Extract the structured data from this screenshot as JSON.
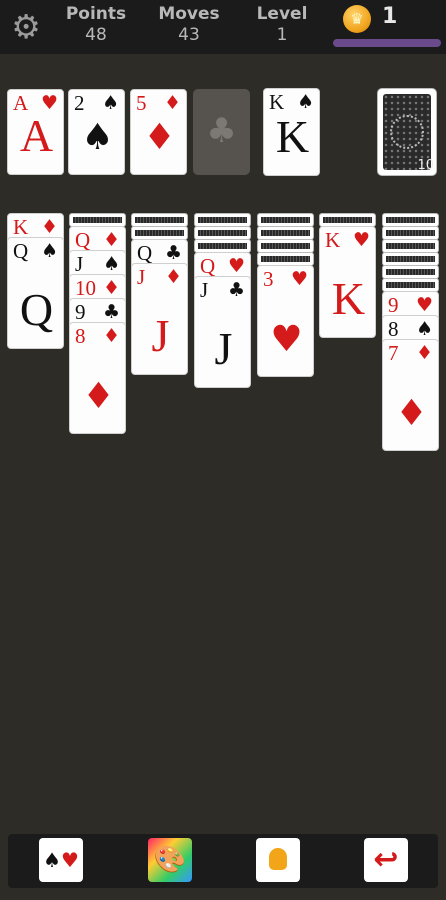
{
  "header": {
    "points_label": "Points",
    "points_value": "48",
    "moves_label": "Moves",
    "moves_value": "43",
    "level_label": "Level",
    "level_value": "1",
    "coins": "1"
  },
  "foundations": [
    {
      "rank": "A",
      "suit": "♥",
      "color": "red"
    },
    {
      "rank": "2",
      "suit": "♠",
      "color": "black"
    },
    {
      "rank": "5",
      "suit": "♦",
      "color": "red"
    },
    {
      "empty": true,
      "suit": "♣"
    }
  ],
  "waste": {
    "rank": "K",
    "suit": "♠",
    "color": "black"
  },
  "stock": {
    "count": "10"
  },
  "tableau": [
    {
      "hidden": 0,
      "cards": [
        {
          "rank": "K",
          "suit": "♦",
          "color": "red"
        },
        {
          "rank": "Q",
          "suit": "♠",
          "color": "black"
        }
      ]
    },
    {
      "hidden": 1,
      "cards": [
        {
          "rank": "Q",
          "suit": "♦",
          "color": "red"
        },
        {
          "rank": "J",
          "suit": "♠",
          "color": "black"
        },
        {
          "rank": "10",
          "suit": "♦",
          "color": "red"
        },
        {
          "rank": "9",
          "suit": "♣",
          "color": "black"
        },
        {
          "rank": "8",
          "suit": "♦",
          "color": "red"
        }
      ]
    },
    {
      "hidden": 2,
      "cards": [
        {
          "rank": "Q",
          "suit": "♣",
          "color": "black"
        },
        {
          "rank": "J",
          "suit": "♦",
          "color": "red"
        }
      ]
    },
    {
      "hidden": 3,
      "cards": [
        {
          "rank": "Q",
          "suit": "♥",
          "color": "red"
        },
        {
          "rank": "J",
          "suit": "♣",
          "color": "black"
        }
      ]
    },
    {
      "hidden": 4,
      "cards": [
        {
          "rank": "3",
          "suit": "♥",
          "color": "red"
        }
      ]
    },
    {
      "hidden": 1,
      "cards": [
        {
          "rank": "K",
          "suit": "♥",
          "color": "red"
        }
      ]
    },
    {
      "hidden": 6,
      "cards": [
        {
          "rank": "9",
          "suit": "♥",
          "color": "red"
        },
        {
          "rank": "8",
          "suit": "♠",
          "color": "black"
        },
        {
          "rank": "7",
          "suit": "♦",
          "color": "red"
        }
      ]
    }
  ],
  "toolbar": {
    "suits_icon": "card-suits-icon",
    "theme_icon": "palette-icon",
    "hint_icon": "lightbulb-icon",
    "undo_icon": "undo-arrow-icon"
  }
}
